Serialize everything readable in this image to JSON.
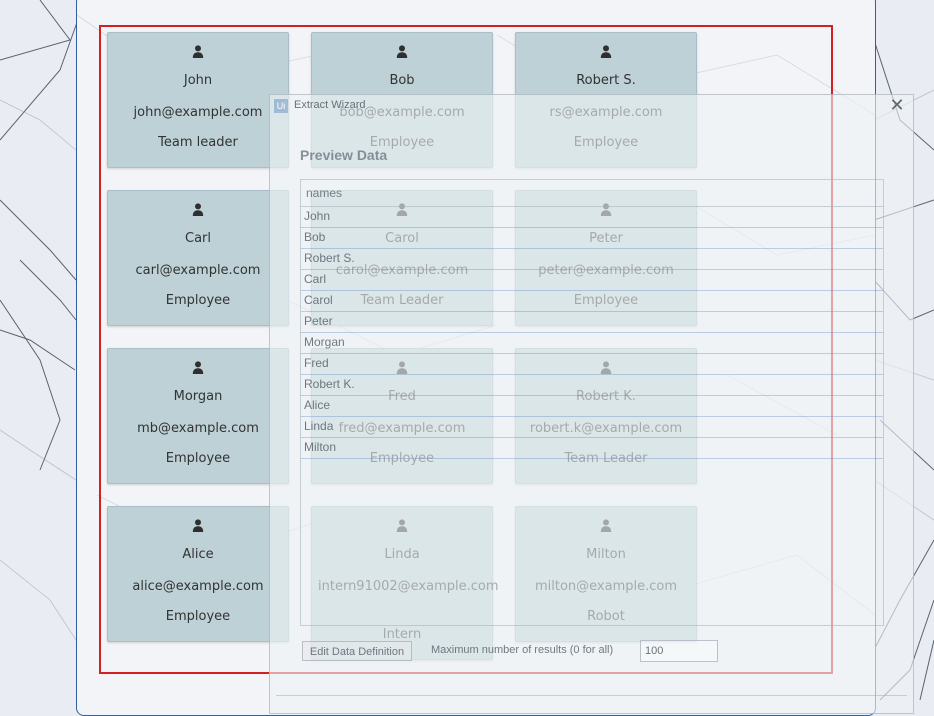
{
  "cards": [
    {
      "name": "John",
      "email": "john@example.com",
      "role": "Team leader"
    },
    {
      "name": "Bob",
      "email": "bob@example.com",
      "role": "Employee"
    },
    {
      "name": "Robert S.",
      "email": "rs@example.com",
      "role": "Employee"
    },
    {
      "name": "Carl",
      "email": "carl@example.com",
      "role": "Employee"
    },
    {
      "name": "Carol",
      "email": "carol@example.com",
      "role": "Team Leader"
    },
    {
      "name": "Peter",
      "email": "peter@example.com",
      "role": "Employee"
    },
    {
      "name": "Morgan",
      "email": "mb@example.com",
      "role": "Employee"
    },
    {
      "name": "Fred",
      "email": "fred@example.com",
      "role": "Employee"
    },
    {
      "name": "Robert K.",
      "email": "robert.k@example.com",
      "role": "Team Leader"
    },
    {
      "name": "Alice",
      "email": "alice@example.com",
      "role": "Employee"
    },
    {
      "name": "Linda",
      "email": "intern91002@example.com",
      "role": "Intern"
    },
    {
      "name": "Milton",
      "email": "milton@example.com",
      "role": "Robot"
    }
  ],
  "wizard": {
    "logo": "Ui",
    "title": "Extract Wizard",
    "close": "✕",
    "heading": "Preview Data",
    "column_header": "names",
    "rows": [
      "John",
      "Bob",
      "Robert S.",
      "Carl",
      "Carol",
      "Peter",
      "Morgan",
      "Fred",
      "Robert K.",
      "Alice",
      "Linda",
      "Milton"
    ],
    "edit_button": "Edit Data Definition",
    "max_results_label": "Maximum number of results (0 for all)",
    "max_results_value": "100"
  },
  "icons": {
    "card_icon": "user-icon"
  }
}
